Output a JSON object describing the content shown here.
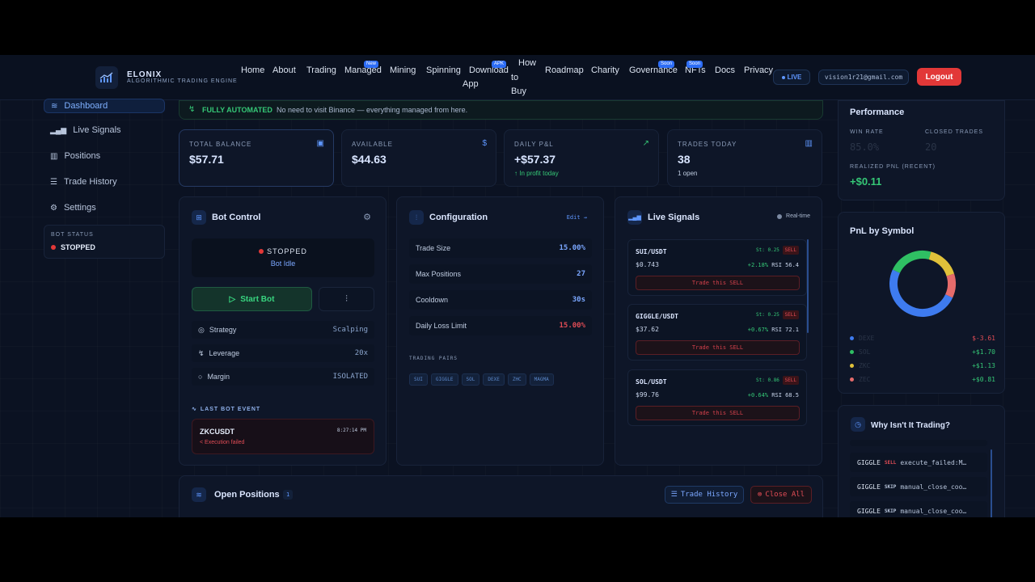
{
  "app": {
    "brand": "ELONIX",
    "brand_sub": "ALGORITHMIC TRADING ENGINE"
  },
  "nav": {
    "items": [
      "Home",
      "About",
      "Trading",
      "Managed",
      "Mining",
      "Spinning",
      "Download",
      "App",
      "How",
      "to",
      "Buy",
      "Roadmap",
      "Charity",
      "Governance",
      "NFTs",
      "Docs",
      "Privacy"
    ],
    "badges": {
      "new": "New",
      "apk": "APK",
      "soon1": "Soon",
      "soon2": "Soon"
    },
    "live": "LIVE",
    "email": "vision1r21@gmail.com",
    "logout": "Logout"
  },
  "sidebar": {
    "items": [
      "Dashboard",
      "Live Signals",
      "Positions",
      "Trade History",
      "Settings"
    ],
    "bot_status_label": "BOT STATUS",
    "bot_status_value": "STOPPED"
  },
  "banner": {
    "title": "FULLY AUTOMATED",
    "text": "No need to visit Binance — everything managed from here."
  },
  "stats": [
    {
      "label": "TOTAL BALANCE",
      "value": "$57.71",
      "sub": ""
    },
    {
      "label": "AVAILABLE",
      "value": "$44.63",
      "sub": ""
    },
    {
      "label": "DAILY P&L",
      "value": "+$57.37",
      "sub": "↑ In profit today"
    },
    {
      "label": "TRADES TODAY",
      "value": "38",
      "sub": "1 open"
    }
  ],
  "bot_control": {
    "title": "Bot Control",
    "status": "STOPPED",
    "substatus": "Bot Idle",
    "start_label": "Start Bot",
    "rows": [
      {
        "label": "Strategy",
        "value": "Scalping"
      },
      {
        "label": "Leverage",
        "value": "20x"
      },
      {
        "label": "Margin",
        "value": "ISOLATED"
      }
    ],
    "last_event_label": "LAST BOT EVENT",
    "event_symbol": "ZKCUSDT",
    "event_time": "8:27:14 PM",
    "event_msg": "< Execution failed"
  },
  "configuration": {
    "title": "Configuration",
    "edit": "Edit →",
    "rows": [
      {
        "label": "Trade Size",
        "value": "15.00%"
      },
      {
        "label": "Max Positions",
        "value": "27"
      },
      {
        "label": "Cooldown",
        "value": "30s"
      },
      {
        "label": "Daily Loss Limit",
        "value": "15.00%"
      }
    ],
    "pairs_label": "TRADING PAIRS",
    "pairs": [
      "SUI",
      "GIGGLE",
      "SOL",
      "DEXE",
      "ZHC",
      "MAGMA"
    ]
  },
  "live_signals": {
    "title": "Live Signals",
    "realtime": "Real-time",
    "signals": [
      {
        "pair": "SUI/USDT",
        "st": "St: 0.25",
        "side": "SELL",
        "price": "$0.743",
        "change": "+2.18%",
        "rsi": "RSI 56.4",
        "action": "Trade this SELL"
      },
      {
        "pair": "GIGGLE/USDT",
        "st": "St: 0.25",
        "side": "SELL",
        "price": "$37.62",
        "change": "+0.67%",
        "rsi": "RSI 72.1",
        "action": "Trade this SELL"
      },
      {
        "pair": "SOL/USDT",
        "st": "St: 0.86",
        "side": "SELL",
        "price": "$99.76",
        "change": "+0.64%",
        "rsi": "RSI 68.5",
        "action": "Trade this SELL"
      }
    ]
  },
  "performance": {
    "title": "Performance",
    "win_rate_label": "WIN RATE",
    "win_rate": "85.0%",
    "closed_label": "CLOSED TRADES",
    "closed": "20",
    "realized_label": "REALIZED PNL (RECENT)",
    "realized": "+$0.11"
  },
  "pnl_by_symbol": {
    "title": "PnL by Symbol",
    "rows": [
      {
        "symbol": "DEXE",
        "value": "$-3.61",
        "color": "#3e7bef"
      },
      {
        "symbol": "SOL",
        "value": "+$1.70",
        "color": "#2fbf63"
      },
      {
        "symbol": "ZKC",
        "value": "+$1.13",
        "color": "#e0c13a"
      },
      {
        "symbol": "ZEC",
        "value": "+$0.81",
        "color": "#e56b6b"
      }
    ],
    "donut": [
      {
        "symbol": "DEXE",
        "share": 0.5
      },
      {
        "symbol": "SOL",
        "share": 0.22
      },
      {
        "symbol": "ZKC",
        "share": 0.16
      },
      {
        "symbol": "ZEC",
        "share": 0.12
      }
    ]
  },
  "why": {
    "title": "Why Isn't It Trading?",
    "rows": [
      {
        "sym": "GIGGLE",
        "tag": "SELL",
        "msg": "execute_failed:M…"
      },
      {
        "sym": "GIGGLE",
        "tag": "SKIP",
        "msg": "manual_close_coo…"
      },
      {
        "sym": "GIGGLE",
        "tag": "SKIP",
        "msg": "manual_close_coo…"
      }
    ]
  },
  "open_positions": {
    "title": "Open Positions",
    "count": "1",
    "trade_history": "Trade History",
    "close_all": "Close All"
  },
  "colors": {
    "accent": "#3e7bef",
    "success": "#35c776",
    "danger": "#e04c55",
    "logout": "#e23838"
  }
}
